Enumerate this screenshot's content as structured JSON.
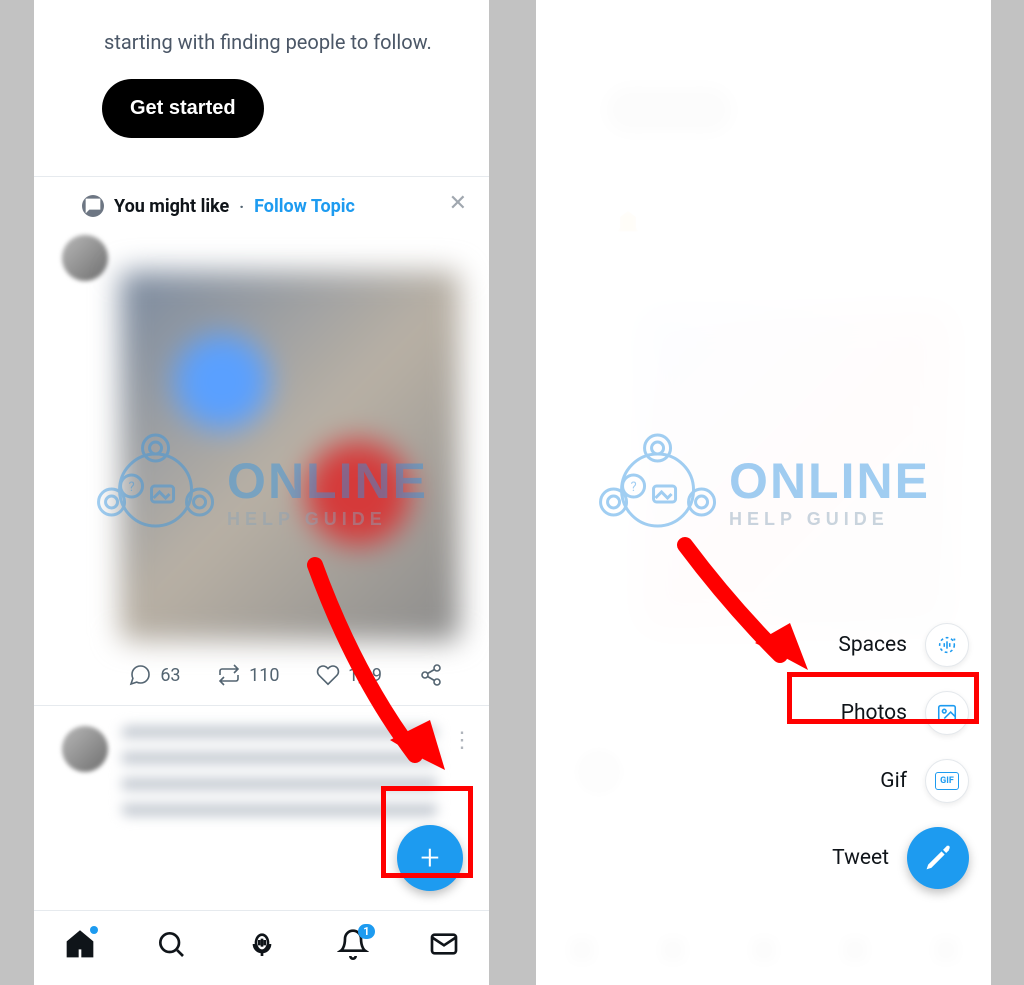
{
  "left": {
    "intro": "starting with finding people to follow.",
    "get_started": "Get started",
    "you_might_like": "You might like",
    "follow_topic": "Follow Topic",
    "stats": {
      "replies": "63",
      "retweets": "110",
      "likes": "1,99"
    },
    "bell_badge": "1"
  },
  "right": {
    "menu": {
      "spaces": "Spaces",
      "photos": "Photos",
      "gif": "Gif",
      "gif_box": "GIF",
      "tweet": "Tweet"
    }
  },
  "watermark": {
    "main": "ONLINE",
    "sub": "HELP GUIDE"
  }
}
